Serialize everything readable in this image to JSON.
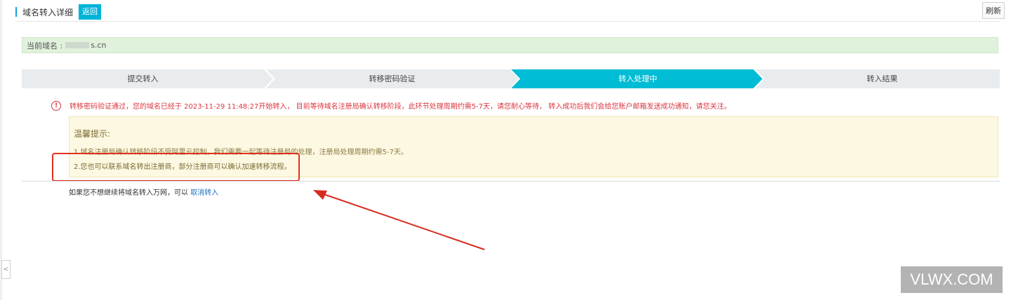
{
  "header": {
    "title": "域名转入详细",
    "back_label": "返回",
    "refresh_label": "刷新"
  },
  "domain": {
    "label": "当前域名 :",
    "value": "s.cn"
  },
  "steps": [
    {
      "label": "提交转入",
      "state": "done"
    },
    {
      "label": "转移密码验证",
      "state": "done"
    },
    {
      "label": "转入处理中",
      "state": "active"
    },
    {
      "label": "转入结果",
      "state": "pending"
    }
  ],
  "colors": {
    "active_step": "#00bcd4",
    "inactive_step": "#e8ecef",
    "error_red": "#d9363e",
    "tips_bg": "#fdf8e2",
    "domain_bg": "#e0f1dc",
    "highlight_red": "#e0301e"
  },
  "notice": {
    "icon": "error-circle-icon",
    "text": "转移密码验证通过，您的域名已经于 2023-11-29 11:48:27开始转入， 目前等待域名注册局确认转移阶段，此环节处理周期约需5-7天，请您耐心等待， 转入成功后我们会给您账户邮箱发送成功通知，请您关注。"
  },
  "tips": {
    "title": "温馨提示:",
    "items": [
      "1.域名注册局确认转移阶段不受阿里云控制，我们需要一起等待注册局的处理，注册局处理周期约需5-7天。",
      "2.您也可以联系域名转出注册商，部分注册商可以确认加速转移流程。"
    ]
  },
  "cancel": {
    "prefix": "如果您不想继续将域名转入万网，可以",
    "link": "取消转入"
  },
  "side_tab": {
    "icon": "chevron-left-icon",
    "glyph": "<"
  },
  "watermark": "VLWX.COM"
}
